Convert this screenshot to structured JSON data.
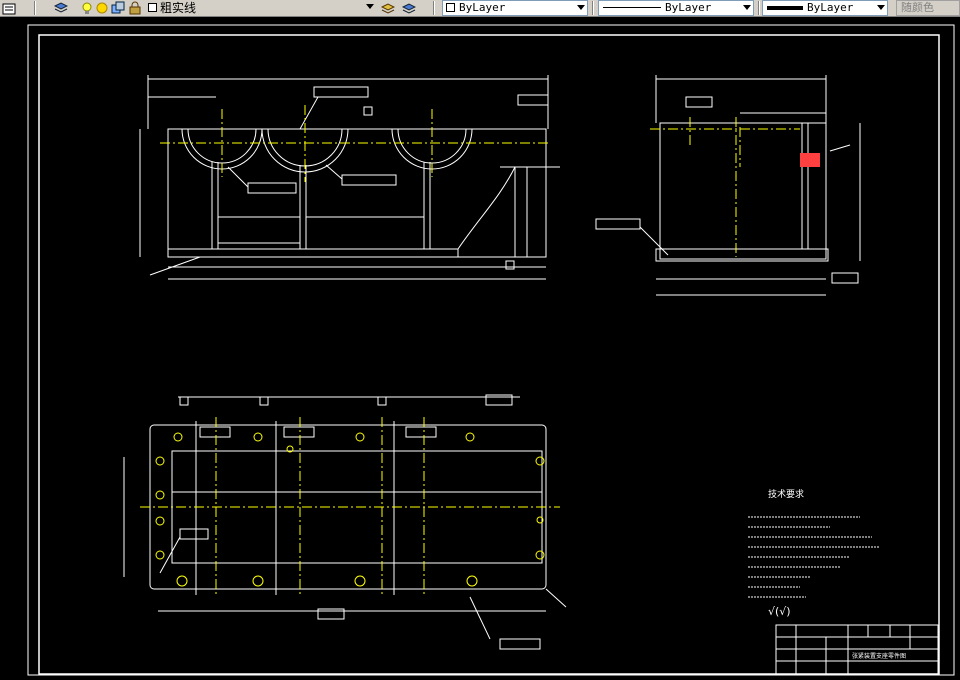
{
  "toolbar": {
    "layer_state_text": "粗实线",
    "color_value": "ByLayer",
    "linetype_value": "ByLayer",
    "lineweight_value": "ByLayer",
    "plotstyle_value": "随颜色"
  },
  "colors": {
    "toolbar_bg": "#d4d0c8",
    "canvas_bg": "#000000",
    "line_white": "#ffffff",
    "center_yellow": "#ffff00",
    "accent_green": "#00ff00"
  },
  "drawing": {
    "tech_req_title": "技术要求",
    "roughness_symbol": "√(√)",
    "title_block": {
      "drawing_title": "张紧装置支座零件图"
    }
  }
}
